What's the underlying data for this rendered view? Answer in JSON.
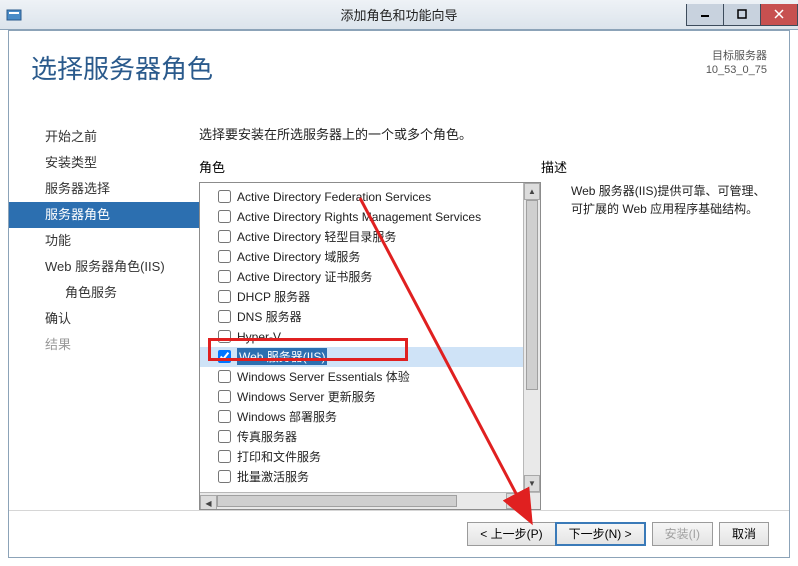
{
  "window": {
    "title": "添加角色和功能向导"
  },
  "page": {
    "title": "选择服务器角色",
    "dest_label": "目标服务器",
    "dest_name": "10_53_0_75",
    "instruction": "选择要安装在所选服务器上的一个或多个角色。",
    "roles_header": "角色",
    "desc_header": "描述",
    "description": "Web 服务器(IIS)提供可靠、可管理、可扩展的 Web 应用程序基础结构。"
  },
  "nav": [
    {
      "label": "开始之前"
    },
    {
      "label": "安装类型"
    },
    {
      "label": "服务器选择"
    },
    {
      "label": "服务器角色",
      "selected": true
    },
    {
      "label": "功能"
    },
    {
      "label": "Web 服务器角色(IIS)"
    },
    {
      "label": "角色服务",
      "sub": true
    },
    {
      "label": "确认"
    },
    {
      "label": "结果",
      "disabled": true
    }
  ],
  "roles": [
    {
      "label": "Active Directory Federation Services",
      "checked": false
    },
    {
      "label": "Active Directory Rights Management Services",
      "checked": false
    },
    {
      "label": "Active Directory 轻型目录服务",
      "checked": false
    },
    {
      "label": "Active Directory 域服务",
      "checked": false
    },
    {
      "label": "Active Directory 证书服务",
      "checked": false
    },
    {
      "label": "DHCP 服务器",
      "checked": false
    },
    {
      "label": "DNS 服务器",
      "checked": false
    },
    {
      "label": "Hyper-V",
      "checked": false
    },
    {
      "label": "Web 服务器(IIS)",
      "checked": true,
      "selected": true
    },
    {
      "label": "Windows Server Essentials 体验",
      "checked": false
    },
    {
      "label": "Windows Server 更新服务",
      "checked": false
    },
    {
      "label": "Windows 部署服务",
      "checked": false
    },
    {
      "label": "传真服务器",
      "checked": false
    },
    {
      "label": "打印和文件服务",
      "checked": false
    },
    {
      "label": "批量激活服务",
      "checked": false
    }
  ],
  "buttons": {
    "prev": "< 上一步(P)",
    "next": "下一步(N) >",
    "install": "安装(I)",
    "cancel": "取消"
  }
}
